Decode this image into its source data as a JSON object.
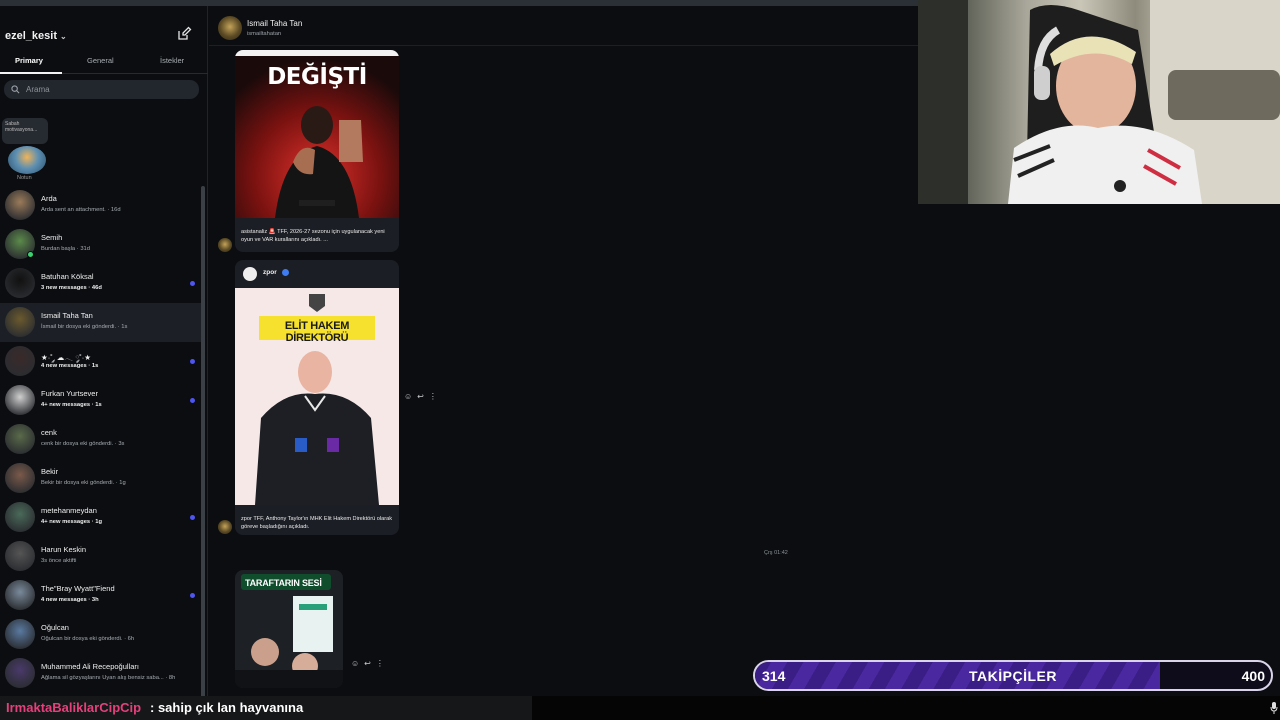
{
  "sidebar": {
    "account": "ezel_kesit",
    "tabs": [
      "Primary",
      "General",
      "İstekler"
    ],
    "search_placeholder": "Arama",
    "note": {
      "bubble": "Sabah motivasyona...",
      "label": "Notun"
    },
    "chats": [
      {
        "name": "Arda",
        "sub": "Arda sent an attachment. · 16d",
        "bold": false,
        "dot": false
      },
      {
        "name": "Semih",
        "sub": "Burdan başla · 31d",
        "bold": false,
        "dot": false,
        "online": true
      },
      {
        "name": "Batuhan Köksal",
        "sub": "3 new messages · 46d",
        "bold": true,
        "dot": true
      },
      {
        "name": "Ismail Taha Tan",
        "sub": "İsmail bir dosya eki gönderdi. · 1s",
        "bold": false,
        "dot": false,
        "selected": true
      },
      {
        "name": "★·˚ ༘ ☁︎𓂃 ༘˚·★",
        "sub": "4 new messages · 1s",
        "bold": true,
        "dot": true
      },
      {
        "name": "Furkan Yurtsever",
        "sub": "4+ new messages · 1s",
        "bold": true,
        "dot": true
      },
      {
        "name": "cenk",
        "sub": "cenk bir dosya eki gönderdi. · 3s",
        "bold": false,
        "dot": false
      },
      {
        "name": "Bekir",
        "sub": "Bekir bir dosya eki gönderdi. · 1g",
        "bold": false,
        "dot": false
      },
      {
        "name": "metehanmeydan",
        "sub": "4+ new messages · 1g",
        "bold": true,
        "dot": true
      },
      {
        "name": "Harun Keskin",
        "sub": "3s önce aktifti",
        "bold": false,
        "dot": false
      },
      {
        "name": "The\"Bray Wyatt\"Fiend",
        "sub": "4 new messages · 3h",
        "bold": true,
        "dot": true
      },
      {
        "name": "Oğulcan",
        "sub": "Oğulcan bir dosya eki gönderdi. · 6h",
        "bold": false,
        "dot": false
      },
      {
        "name": "Muhammed Ali Recepoğulları",
        "sub": "Ağlama sil gözyaşlarını Uyan alış bensiz saba... · 8h",
        "bold": false,
        "dot": false
      }
    ]
  },
  "conversation": {
    "name": "Ismail Taha Tan",
    "username": "ismailtahatan",
    "post1": {
      "headline": "DEĞİŞTİ",
      "caption": "asistanaliz 🚨 TFF, 2026-27 sezonu için uygulanacak yeni oyun ve VAR kurallarını açıkladı. ..."
    },
    "post2": {
      "author": "zpor",
      "banner": "ELİT HAKEM DİREKTÖRÜ",
      "caption": "zpor TFF, Anthony Taylor'ın MHK Elit Hakem Direktörü olarak göreve başladığını açıkladı."
    },
    "timestamp": "Çrş 01:42",
    "post3": {
      "banner": "TARAFTARIN SESİ"
    }
  },
  "overlay": {
    "followers_current": "314",
    "followers_label": "TAKİPÇİLER",
    "followers_goal": "400",
    "followers_fraction": 0.785,
    "chat_user": "IrmaktaBaliklarCipCip",
    "chat_message": ": sahip çık lan hayvanına"
  }
}
